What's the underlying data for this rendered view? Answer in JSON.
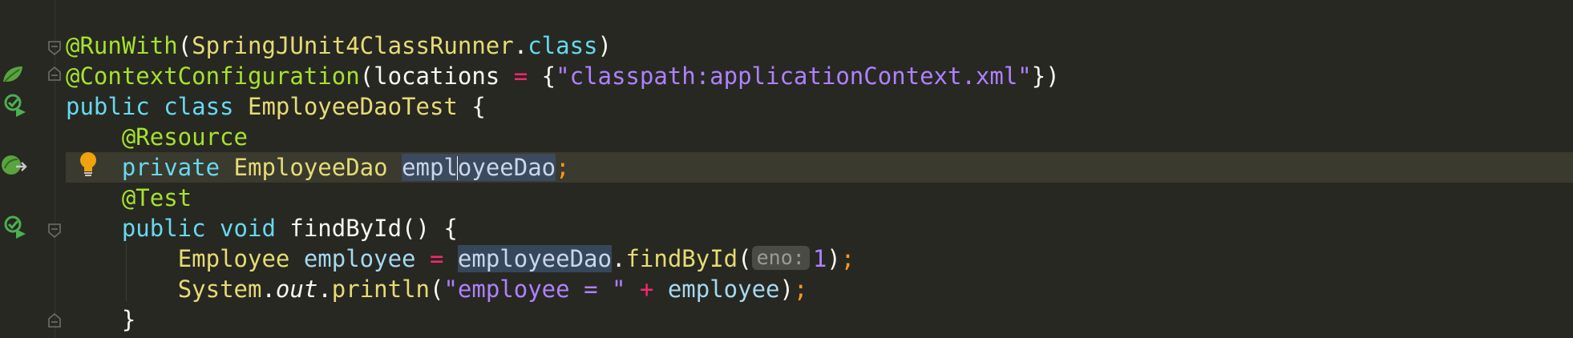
{
  "code_lines": [
    {
      "tokens": [
        {
          "t": "@RunWith",
          "c": "ann"
        },
        {
          "t": "(",
          "c": "pl"
        },
        {
          "t": "SpringJUnit4ClassRunner",
          "c": "cls"
        },
        {
          "t": ".",
          "c": "pl"
        },
        {
          "t": "class",
          "c": "kw"
        },
        {
          "t": ")",
          "c": "pl"
        }
      ]
    },
    {
      "tokens": [
        {
          "t": "@ContextConfiguration",
          "c": "ann"
        },
        {
          "t": "(",
          "c": "pl"
        },
        {
          "t": "locations",
          "c": "pl"
        },
        {
          "t": " = ",
          "c": "op"
        },
        {
          "t": "{",
          "c": "pl"
        },
        {
          "t": "\"classpath:applicationContext.xml\"",
          "c": "str"
        },
        {
          "t": "})",
          "c": "pl"
        }
      ]
    },
    {
      "tokens": [
        {
          "t": "public class ",
          "c": "kw"
        },
        {
          "t": "EmployeeDaoTest",
          "c": "cls"
        },
        {
          "t": " {",
          "c": "pl"
        }
      ]
    },
    {
      "tokens": [
        {
          "t": "    ",
          "c": "pl"
        },
        {
          "t": "@Resource",
          "c": "ann"
        }
      ]
    },
    {
      "tokens": [
        {
          "t": "    ",
          "c": "pl"
        },
        {
          "t": "private ",
          "c": "kw"
        },
        {
          "t": "EmployeeDao",
          "c": "cls"
        },
        {
          "t": " ",
          "c": "pl"
        },
        {
          "t": "empl",
          "c": "sel"
        },
        {
          "caret": true
        },
        {
          "t": "oyeeDao",
          "c": "sel"
        },
        {
          "t": ";",
          "c": "semi"
        }
      ]
    },
    {
      "tokens": [
        {
          "t": "    ",
          "c": "pl"
        },
        {
          "t": "@Test",
          "c": "ann"
        }
      ]
    },
    {
      "tokens": [
        {
          "t": "    ",
          "c": "pl"
        },
        {
          "t": "public void ",
          "c": "kw"
        },
        {
          "t": "findById",
          "c": "pl"
        },
        {
          "t": "() {",
          "c": "pl"
        }
      ]
    },
    {
      "tokens": [
        {
          "t": "        ",
          "c": "pl"
        },
        {
          "t": "Employee",
          "c": "cls"
        },
        {
          "t": " ",
          "c": "pl"
        },
        {
          "t": "employee",
          "c": "var"
        },
        {
          "t": " = ",
          "c": "op"
        },
        {
          "t": "employeeDao",
          "c": "sel2"
        },
        {
          "t": ".",
          "c": "pl"
        },
        {
          "t": "findById",
          "c": "fn"
        },
        {
          "t": "(",
          "c": "pl"
        },
        {
          "hint": "eno:"
        },
        {
          "t": "1",
          "c": "num"
        },
        {
          "t": ")",
          "c": "pl"
        },
        {
          "t": ";",
          "c": "semi"
        }
      ]
    },
    {
      "tokens": [
        {
          "t": "        ",
          "c": "pl"
        },
        {
          "t": "System",
          "c": "cls"
        },
        {
          "t": ".",
          "c": "pl"
        },
        {
          "t": "out",
          "c": "it"
        },
        {
          "t": ".",
          "c": "pl"
        },
        {
          "t": "println",
          "c": "fn"
        },
        {
          "t": "(",
          "c": "pl"
        },
        {
          "t": "\"employee = \"",
          "c": "str"
        },
        {
          "t": " + ",
          "c": "op"
        },
        {
          "t": "employee",
          "c": "var"
        },
        {
          "t": ")",
          "c": "pl"
        },
        {
          "t": ";",
          "c": "semi"
        }
      ]
    },
    {
      "tokens": [
        {
          "t": "    ",
          "c": "pl"
        },
        {
          "t": "}",
          "c": "pl"
        }
      ]
    }
  ],
  "gutter_icons": [
    {
      "line": 1,
      "icon": "spring-bean-icon"
    },
    {
      "line": 2,
      "icon": "run-test-icon"
    },
    {
      "line": 4,
      "icon": "spring-autowired-icon"
    },
    {
      "line": 6,
      "icon": "run-test-icon"
    }
  ],
  "colors": {
    "background": "#272822",
    "current_line": "#3a3a2f",
    "annotation": "#a6e22e",
    "keyword": "#66d9ef",
    "class_name": "#e6db74",
    "string": "#ae81ff",
    "operator": "#f92672"
  }
}
